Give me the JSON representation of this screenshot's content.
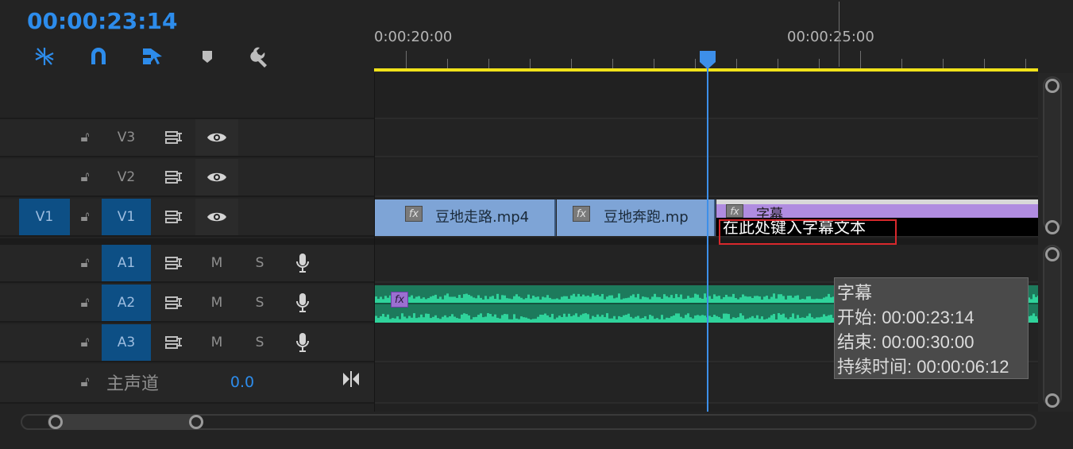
{
  "timecode": "00:00:23:14",
  "toolbar": {
    "icons": [
      "insert-overwrite-icon",
      "snap-magnet-icon",
      "linked-selection-icon",
      "marker-icon",
      "wrench-icon"
    ]
  },
  "ruler": {
    "label_left": "0:00:20:00",
    "label_right": "00:00:25:00"
  },
  "tracks": {
    "v3": {
      "label": "V3"
    },
    "v2": {
      "label": "V2"
    },
    "v1": {
      "source": "V1",
      "label": "V1"
    },
    "a1": {
      "label": "A1",
      "m": "M",
      "s": "S"
    },
    "a2": {
      "label": "A2",
      "m": "M",
      "s": "S"
    },
    "a3": {
      "label": "A3",
      "m": "M",
      "s": "S"
    },
    "master": {
      "label": "主声道",
      "value": "0.0"
    }
  },
  "clips": {
    "clip1": {
      "fx": "fx",
      "name": "豆地走路.mp4"
    },
    "clip2": {
      "fx": "fx",
      "name": "豆地奔跑.mp"
    },
    "caption": {
      "fx": "fx",
      "name": "字幕",
      "placeholder": "在此处键入字幕文本"
    },
    "audio": {
      "fx": "fx"
    }
  },
  "tooltip": {
    "title": "字幕",
    "start": "开始: 00:00:23:14",
    "end": "结束: 00:00:30:00",
    "duration": "持续时间: 00:00:06:12"
  },
  "colors": {
    "accent": "#2d8ceb",
    "work_area": "#f0e21a",
    "video_clip": "#7ea4d6",
    "caption_clip": "#b08ce0",
    "audio_clip": "#1d7a5c",
    "highlight_box": "#d8282c"
  }
}
